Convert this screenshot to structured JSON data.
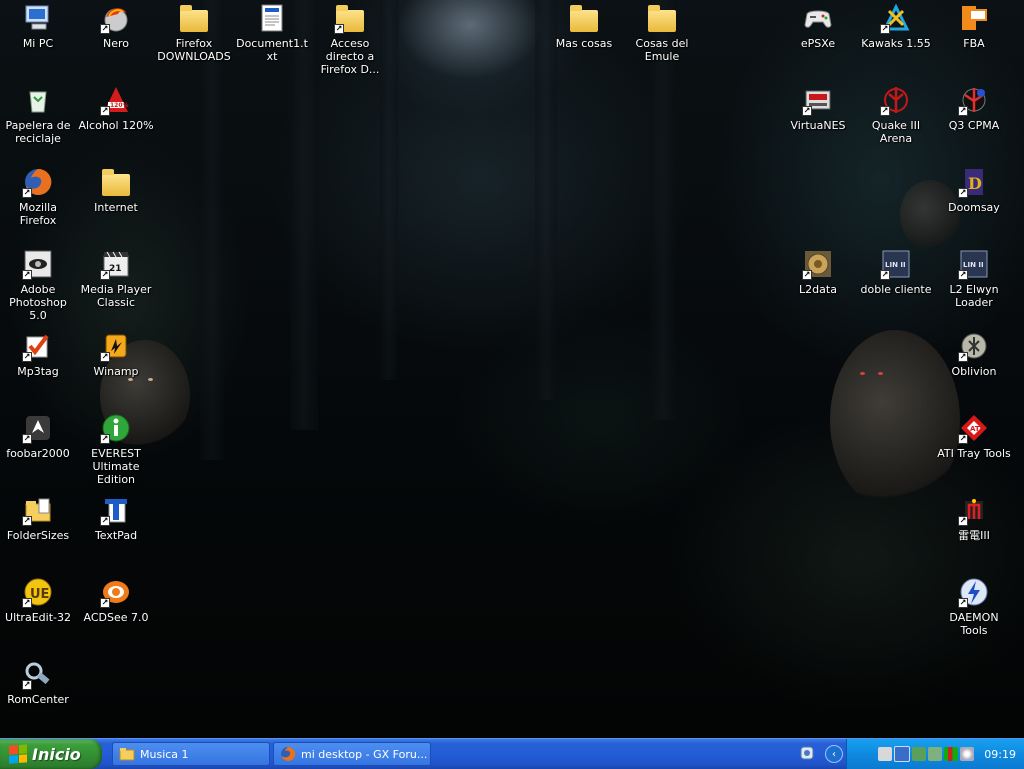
{
  "desktop": {
    "icons_left": [
      {
        "label": "Mi PC",
        "icon": "computer-icon"
      },
      {
        "label": "Papelera de reciclaje",
        "icon": "recycle-bin-icon"
      },
      {
        "label": "Mozilla Firefox",
        "icon": "firefox-icon"
      },
      {
        "label": "Adobe Photoshop 5.0",
        "icon": "photoshop-icon"
      },
      {
        "label": "Mp3tag",
        "icon": "mp3tag-icon"
      },
      {
        "label": "foobar2000",
        "icon": "foobar-icon"
      },
      {
        "label": "FolderSizes",
        "icon": "foldersizes-icon"
      },
      {
        "label": "UltraEdit-32",
        "icon": "ultraedit-icon"
      },
      {
        "label": "RomCenter",
        "icon": "romcenter-icon"
      }
    ],
    "icons_col2": [
      {
        "label": "Nero",
        "icon": "nero-icon"
      },
      {
        "label": "Alcohol 120%",
        "icon": "alcohol-icon"
      },
      {
        "label": "Internet",
        "icon": "folder-icon"
      },
      {
        "label": "Media Player Classic",
        "icon": "media-player-icon"
      },
      {
        "label": "Winamp",
        "icon": "winamp-icon"
      },
      {
        "label": "EVEREST Ultimate Edition",
        "icon": "everest-icon"
      },
      {
        "label": "TextPad",
        "icon": "textpad-icon"
      },
      {
        "label": "ACDSee 7.0",
        "icon": "acdsee-icon"
      }
    ],
    "icons_top": [
      {
        "label": "Firefox DOWNLOADS",
        "icon": "folder-icon"
      },
      {
        "label": "Document1.txt",
        "icon": "text-document-icon"
      },
      {
        "label": "Acceso directo a Firefox D...",
        "icon": "folder-icon"
      },
      {
        "label": "Mas cosas",
        "icon": "folder-icon"
      },
      {
        "label": "Cosas del Emule",
        "icon": "folder-icon"
      }
    ],
    "icons_right_col1": [
      {
        "label": "ePSXe",
        "icon": "gamepad-icon"
      },
      {
        "label": "VirtuaNES",
        "icon": "nes-icon"
      },
      {
        "label": "L2data",
        "icon": "l2data-icon"
      }
    ],
    "icons_right_col2": [
      {
        "label": "Kawaks 1.55",
        "icon": "kawaks-icon"
      },
      {
        "label": "Quake III Arena",
        "icon": "quake-icon"
      },
      {
        "label": "doble cliente",
        "icon": "lineage-icon"
      }
    ],
    "icons_right_col3": [
      {
        "label": "FBA",
        "icon": "fba-icon"
      },
      {
        "label": "Q3 CPMA",
        "icon": "q3cpma-icon"
      },
      {
        "label": "Doomsay",
        "icon": "doomsay-icon"
      },
      {
        "label": "L2 Elwyn Loader",
        "icon": "lineage-icon"
      },
      {
        "label": "Oblivion",
        "icon": "oblivion-icon"
      },
      {
        "label": "ATI Tray Tools",
        "icon": "ati-icon"
      },
      {
        "label": "雷電III",
        "icon": "raiden-icon"
      },
      {
        "label": "DAEMON Tools",
        "icon": "daemon-tools-icon"
      }
    ]
  },
  "taskbar": {
    "start_label": "Inicio",
    "tasks": [
      {
        "label": "Musica 1",
        "icon": "folder-icon"
      },
      {
        "label": "mi desktop - GX Foru...",
        "icon": "firefox-icon"
      }
    ],
    "tray_icons": [
      "winamp-tray-icon",
      "network-tray-icon",
      "users-tray-icon",
      "users2-tray-icon",
      "meter-tray-icon",
      "daemon-tray-icon"
    ],
    "clock": "09:19"
  }
}
